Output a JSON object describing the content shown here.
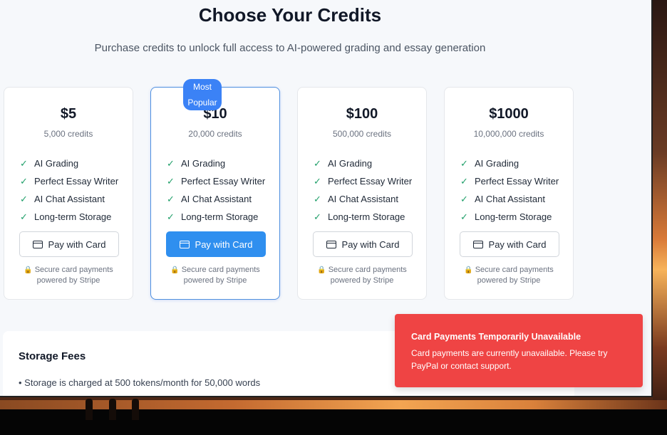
{
  "header": {
    "title": "Choose Your Credits",
    "subtitle": "Purchase credits to unlock full access to AI-powered grading and essay generation"
  },
  "plans": [
    {
      "price": "$5",
      "credits": "5,000 credits",
      "badge": ""
    },
    {
      "price": "$10",
      "credits": "20,000 credits",
      "badge": "Most Popular"
    },
    {
      "price": "$100",
      "credits": "500,000 credits",
      "badge": ""
    },
    {
      "price": "$1000",
      "credits": "10,000,000 credits",
      "badge": ""
    }
  ],
  "features": [
    "AI Grading",
    "Perfect Essay Writer",
    "AI Chat Assistant",
    "Long-term Storage"
  ],
  "pay_label": "Pay with Card",
  "secure_line1": "Secure card payments",
  "secure_line2": "powered by Stripe",
  "storage": {
    "title": "Storage Fees",
    "line": "• Storage is charged at 500 tokens/month for 50,000 words"
  },
  "toast": {
    "title": "Card Payments Temporarily Unavailable",
    "message": "Card payments are currently unavailable. Please try PayPal or contact support."
  },
  "colors": {
    "primary": "#2f8fef",
    "badge": "#3b82f6",
    "check": "#22a06b",
    "toast": "#ef4444"
  }
}
